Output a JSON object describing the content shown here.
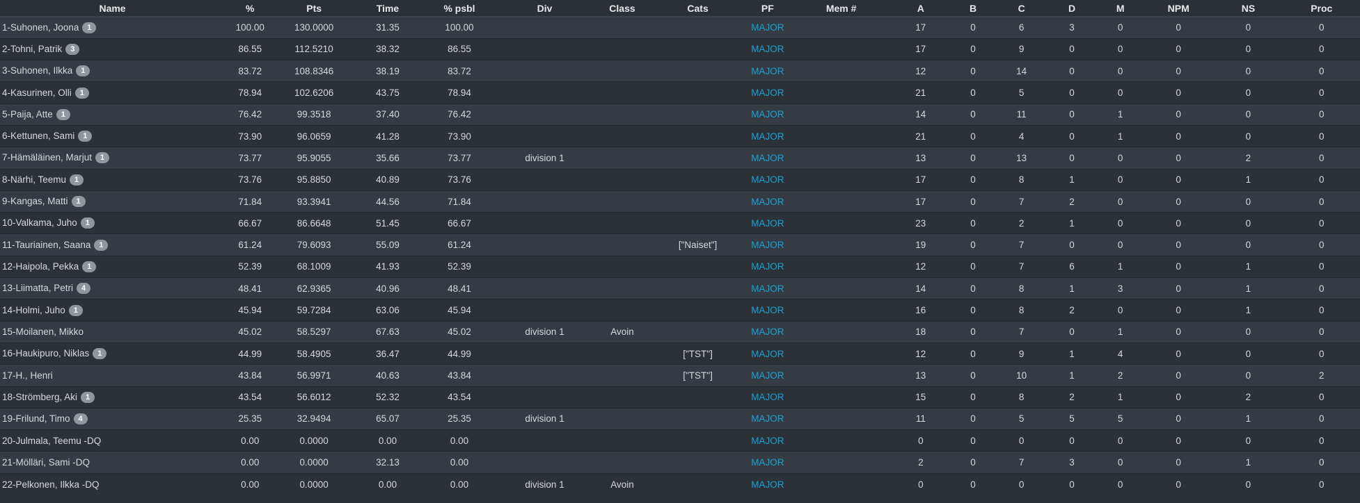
{
  "columns": [
    "Name",
    "%",
    "Pts",
    "Time",
    "% psbl",
    "Div",
    "Class",
    "Cats",
    "PF",
    "Mem #",
    "A",
    "B",
    "C",
    "D",
    "M",
    "NPM",
    "NS",
    "Proc"
  ],
  "rows": [
    {
      "name": "1-Suhonen, Joona",
      "badge": "1",
      "pct": "100.00",
      "pts": "130.0000",
      "time": "31.35",
      "psbl": "100.00",
      "div": "",
      "cls": "",
      "cats": "",
      "pf": "MAJOR",
      "mem": "",
      "a": "17",
      "b": "0",
      "c": "6",
      "d": "3",
      "m": "0",
      "npm": "0",
      "ns": "0",
      "proc": "0"
    },
    {
      "name": "2-Tohni, Patrik",
      "badge": "3",
      "pct": "86.55",
      "pts": "112.5210",
      "time": "38.32",
      "psbl": "86.55",
      "div": "",
      "cls": "",
      "cats": "",
      "pf": "MAJOR",
      "mem": "",
      "a": "17",
      "b": "0",
      "c": "9",
      "d": "0",
      "m": "0",
      "npm": "0",
      "ns": "0",
      "proc": "0"
    },
    {
      "name": "3-Suhonen, Ilkka",
      "badge": "1",
      "pct": "83.72",
      "pts": "108.8346",
      "time": "38.19",
      "psbl": "83.72",
      "div": "",
      "cls": "",
      "cats": "",
      "pf": "MAJOR",
      "mem": "",
      "a": "12",
      "b": "0",
      "c": "14",
      "d": "0",
      "m": "0",
      "npm": "0",
      "ns": "0",
      "proc": "0"
    },
    {
      "name": "4-Kasurinen, Olli",
      "badge": "1",
      "pct": "78.94",
      "pts": "102.6206",
      "time": "43.75",
      "psbl": "78.94",
      "div": "",
      "cls": "",
      "cats": "",
      "pf": "MAJOR",
      "mem": "",
      "a": "21",
      "b": "0",
      "c": "5",
      "d": "0",
      "m": "0",
      "npm": "0",
      "ns": "0",
      "proc": "0"
    },
    {
      "name": "5-Paija, Atte",
      "badge": "1",
      "pct": "76.42",
      "pts": "99.3518",
      "time": "37.40",
      "psbl": "76.42",
      "div": "",
      "cls": "",
      "cats": "",
      "pf": "MAJOR",
      "mem": "",
      "a": "14",
      "b": "0",
      "c": "11",
      "d": "0",
      "m": "1",
      "npm": "0",
      "ns": "0",
      "proc": "0"
    },
    {
      "name": "6-Kettunen, Sami",
      "badge": "1",
      "pct": "73.90",
      "pts": "96.0659",
      "time": "41.28",
      "psbl": "73.90",
      "div": "",
      "cls": "",
      "cats": "",
      "pf": "MAJOR",
      "mem": "",
      "a": "21",
      "b": "0",
      "c": "4",
      "d": "0",
      "m": "1",
      "npm": "0",
      "ns": "0",
      "proc": "0"
    },
    {
      "name": "7-Hämäläinen, Marjut",
      "badge": "1",
      "pct": "73.77",
      "pts": "95.9055",
      "time": "35.66",
      "psbl": "73.77",
      "div": "division 1",
      "cls": "",
      "cats": "",
      "pf": "MAJOR",
      "mem": "",
      "a": "13",
      "b": "0",
      "c": "13",
      "d": "0",
      "m": "0",
      "npm": "0",
      "ns": "2",
      "proc": "0"
    },
    {
      "name": "8-Närhi, Teemu",
      "badge": "1",
      "pct": "73.76",
      "pts": "95.8850",
      "time": "40.89",
      "psbl": "73.76",
      "div": "",
      "cls": "",
      "cats": "",
      "pf": "MAJOR",
      "mem": "",
      "a": "17",
      "b": "0",
      "c": "8",
      "d": "1",
      "m": "0",
      "npm": "0",
      "ns": "1",
      "proc": "0"
    },
    {
      "name": "9-Kangas, Matti",
      "badge": "1",
      "pct": "71.84",
      "pts": "93.3941",
      "time": "44.56",
      "psbl": "71.84",
      "div": "",
      "cls": "",
      "cats": "",
      "pf": "MAJOR",
      "mem": "",
      "a": "17",
      "b": "0",
      "c": "7",
      "d": "2",
      "m": "0",
      "npm": "0",
      "ns": "0",
      "proc": "0"
    },
    {
      "name": "10-Valkama, Juho",
      "badge": "1",
      "pct": "66.67",
      "pts": "86.6648",
      "time": "51.45",
      "psbl": "66.67",
      "div": "",
      "cls": "",
      "cats": "",
      "pf": "MAJOR",
      "mem": "",
      "a": "23",
      "b": "0",
      "c": "2",
      "d": "1",
      "m": "0",
      "npm": "0",
      "ns": "0",
      "proc": "0"
    },
    {
      "name": "11-Tauriainen, Saana",
      "badge": "1",
      "pct": "61.24",
      "pts": "79.6093",
      "time": "55.09",
      "psbl": "61.24",
      "div": "",
      "cls": "",
      "cats": "[\"Naiset\"]",
      "pf": "MAJOR",
      "mem": "",
      "a": "19",
      "b": "0",
      "c": "7",
      "d": "0",
      "m": "0",
      "npm": "0",
      "ns": "0",
      "proc": "0"
    },
    {
      "name": "12-Haipola, Pekka",
      "badge": "1",
      "pct": "52.39",
      "pts": "68.1009",
      "time": "41.93",
      "psbl": "52.39",
      "div": "",
      "cls": "",
      "cats": "",
      "pf": "MAJOR",
      "mem": "",
      "a": "12",
      "b": "0",
      "c": "7",
      "d": "6",
      "m": "1",
      "npm": "0",
      "ns": "1",
      "proc": "0"
    },
    {
      "name": "13-Liimatta, Petri",
      "badge": "4",
      "pct": "48.41",
      "pts": "62.9365",
      "time": "40.96",
      "psbl": "48.41",
      "div": "",
      "cls": "",
      "cats": "",
      "pf": "MAJOR",
      "mem": "",
      "a": "14",
      "b": "0",
      "c": "8",
      "d": "1",
      "m": "3",
      "npm": "0",
      "ns": "1",
      "proc": "0"
    },
    {
      "name": "14-Holmi, Juho",
      "badge": "1",
      "pct": "45.94",
      "pts": "59.7284",
      "time": "63.06",
      "psbl": "45.94",
      "div": "",
      "cls": "",
      "cats": "",
      "pf": "MAJOR",
      "mem": "",
      "a": "16",
      "b": "0",
      "c": "8",
      "d": "2",
      "m": "0",
      "npm": "0",
      "ns": "1",
      "proc": "0"
    },
    {
      "name": "15-Moilanen, Mikko",
      "badge": "",
      "pct": "45.02",
      "pts": "58.5297",
      "time": "67.63",
      "psbl": "45.02",
      "div": "division 1",
      "cls": "Avoin",
      "cats": "",
      "pf": "MAJOR",
      "mem": "",
      "a": "18",
      "b": "0",
      "c": "7",
      "d": "0",
      "m": "1",
      "npm": "0",
      "ns": "0",
      "proc": "0"
    },
    {
      "name": "16-Haukipuro, Niklas",
      "badge": "1",
      "pct": "44.99",
      "pts": "58.4905",
      "time": "36.47",
      "psbl": "44.99",
      "div": "",
      "cls": "",
      "cats": "[\"TST\"]",
      "pf": "MAJOR",
      "mem": "",
      "a": "12",
      "b": "0",
      "c": "9",
      "d": "1",
      "m": "4",
      "npm": "0",
      "ns": "0",
      "proc": "0"
    },
    {
      "name": "17-H., Henri",
      "badge": "",
      "pct": "43.84",
      "pts": "56.9971",
      "time": "40.63",
      "psbl": "43.84",
      "div": "",
      "cls": "",
      "cats": "[\"TST\"]",
      "pf": "MAJOR",
      "mem": "",
      "a": "13",
      "b": "0",
      "c": "10",
      "d": "1",
      "m": "2",
      "npm": "0",
      "ns": "0",
      "proc": "2"
    },
    {
      "name": "18-Strömberg, Aki",
      "badge": "1",
      "pct": "43.54",
      "pts": "56.6012",
      "time": "52.32",
      "psbl": "43.54",
      "div": "",
      "cls": "",
      "cats": "",
      "pf": "MAJOR",
      "mem": "",
      "a": "15",
      "b": "0",
      "c": "8",
      "d": "2",
      "m": "1",
      "npm": "0",
      "ns": "2",
      "proc": "0"
    },
    {
      "name": "19-Frilund, Timo",
      "badge": "4",
      "pct": "25.35",
      "pts": "32.9494",
      "time": "65.07",
      "psbl": "25.35",
      "div": "division 1",
      "cls": "",
      "cats": "",
      "pf": "MAJOR",
      "mem": "",
      "a": "11",
      "b": "0",
      "c": "5",
      "d": "5",
      "m": "5",
      "npm": "0",
      "ns": "1",
      "proc": "0"
    },
    {
      "name": "20-Julmala, Teemu -DQ",
      "badge": "",
      "pct": "0.00",
      "pts": "0.0000",
      "time": "0.00",
      "psbl": "0.00",
      "div": "",
      "cls": "",
      "cats": "",
      "pf": "MAJOR",
      "mem": "",
      "a": "0",
      "b": "0",
      "c": "0",
      "d": "0",
      "m": "0",
      "npm": "0",
      "ns": "0",
      "proc": "0"
    },
    {
      "name": "21-Mölläri, Sami -DQ",
      "badge": "",
      "pct": "0.00",
      "pts": "0.0000",
      "time": "32.13",
      "psbl": "0.00",
      "div": "",
      "cls": "",
      "cats": "",
      "pf": "MAJOR",
      "mem": "",
      "a": "2",
      "b": "0",
      "c": "7",
      "d": "3",
      "m": "0",
      "npm": "0",
      "ns": "1",
      "proc": "0"
    },
    {
      "name": "22-Pelkonen, Ilkka -DQ",
      "badge": "",
      "pct": "0.00",
      "pts": "0.0000",
      "time": "0.00",
      "psbl": "0.00",
      "div": "division 1",
      "cls": "Avoin",
      "cats": "",
      "pf": "MAJOR",
      "mem": "",
      "a": "0",
      "b": "0",
      "c": "0",
      "d": "0",
      "m": "0",
      "npm": "0",
      "ns": "0",
      "proc": "0"
    }
  ],
  "colors": {
    "background": "#2b3036",
    "row_odd": "#353b42",
    "row_even": "#2c3137",
    "link": "#1aa3d6",
    "badge": "#8f969c"
  }
}
